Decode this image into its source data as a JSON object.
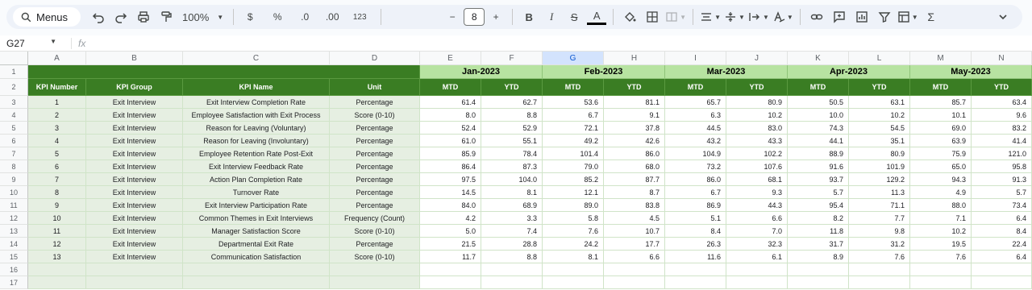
{
  "toolbar": {
    "menus_label": "Menus",
    "zoom": "100%",
    "currency": "$",
    "percent": "%",
    "dec_decrease": ".0",
    "dec_increase": ".00",
    "number_format": "123",
    "font_size": "8",
    "sum_symbol": "Σ"
  },
  "formula_bar": {
    "cell_ref": "G27",
    "fx": "fx"
  },
  "columns": [
    "A",
    "B",
    "C",
    "D",
    "E",
    "F",
    "G",
    "H",
    "I",
    "J",
    "K",
    "L",
    "M",
    "N"
  ],
  "selected_column": "G",
  "rows": [
    "1",
    "2",
    "3",
    "4",
    "5",
    "6",
    "7",
    "8",
    "9",
    "10",
    "11",
    "12",
    "13",
    "14",
    "15",
    "16",
    "17"
  ],
  "months": [
    "Jan-2023",
    "Feb-2023",
    "Mar-2023",
    "Apr-2023",
    "May-2023"
  ],
  "headers": {
    "kpi_number": "KPI Number",
    "kpi_group": "KPI Group",
    "kpi_name": "KPI Name",
    "unit": "Unit",
    "mtd": "MTD",
    "ytd": "YTD"
  },
  "data": [
    {
      "num": "1",
      "group": "Exit Interview",
      "name": "Exit Interview Completion Rate",
      "unit": "Percentage",
      "vals": [
        "61.4",
        "62.7",
        "53.6",
        "81.1",
        "65.7",
        "80.9",
        "50.5",
        "63.1",
        "85.7",
        "63.4"
      ]
    },
    {
      "num": "2",
      "group": "Exit Interview",
      "name": "Employee Satisfaction with Exit Process",
      "unit": "Score (0-10)",
      "vals": [
        "8.0",
        "8.8",
        "6.7",
        "9.1",
        "6.3",
        "10.2",
        "10.0",
        "10.2",
        "10.1",
        "9.6"
      ]
    },
    {
      "num": "3",
      "group": "Exit Interview",
      "name": "Reason for Leaving (Voluntary)",
      "unit": "Percentage",
      "vals": [
        "52.4",
        "52.9",
        "72.1",
        "37.8",
        "44.5",
        "83.0",
        "74.3",
        "54.5",
        "69.0",
        "83.2"
      ]
    },
    {
      "num": "4",
      "group": "Exit Interview",
      "name": "Reason for Leaving (Involuntary)",
      "unit": "Percentage",
      "vals": [
        "61.0",
        "55.1",
        "49.2",
        "42.6",
        "43.2",
        "43.3",
        "44.1",
        "35.1",
        "63.9",
        "41.4"
      ]
    },
    {
      "num": "5",
      "group": "Exit Interview",
      "name": "Employee Retention Rate Post-Exit",
      "unit": "Percentage",
      "vals": [
        "85.9",
        "78.4",
        "101.4",
        "86.0",
        "104.9",
        "102.2",
        "88.9",
        "80.9",
        "75.9",
        "121.0"
      ]
    },
    {
      "num": "6",
      "group": "Exit Interview",
      "name": "Exit Interview Feedback Rate",
      "unit": "Percentage",
      "vals": [
        "86.4",
        "87.3",
        "79.0",
        "68.0",
        "73.2",
        "107.6",
        "91.6",
        "101.9",
        "65.0",
        "95.8"
      ]
    },
    {
      "num": "7",
      "group": "Exit Interview",
      "name": "Action Plan Completion Rate",
      "unit": "Percentage",
      "vals": [
        "97.5",
        "104.0",
        "85.2",
        "87.7",
        "86.0",
        "68.1",
        "93.7",
        "129.2",
        "94.3",
        "91.3"
      ]
    },
    {
      "num": "8",
      "group": "Exit Interview",
      "name": "Turnover Rate",
      "unit": "Percentage",
      "vals": [
        "14.5",
        "8.1",
        "12.1",
        "8.7",
        "6.7",
        "9.3",
        "5.7",
        "11.3",
        "4.9",
        "5.7"
      ]
    },
    {
      "num": "9",
      "group": "Exit Interview",
      "name": "Exit Interview Participation Rate",
      "unit": "Percentage",
      "vals": [
        "84.0",
        "68.9",
        "89.0",
        "83.8",
        "86.9",
        "44.3",
        "95.4",
        "71.1",
        "88.0",
        "73.4"
      ]
    },
    {
      "num": "10",
      "group": "Exit Interview",
      "name": "Common Themes in Exit Interviews",
      "unit": "Frequency (Count)",
      "vals": [
        "4.2",
        "3.3",
        "5.8",
        "4.5",
        "5.1",
        "6.6",
        "8.2",
        "7.7",
        "7.1",
        "6.4"
      ]
    },
    {
      "num": "11",
      "group": "Exit Interview",
      "name": "Manager Satisfaction Score",
      "unit": "Score (0-10)",
      "vals": [
        "5.0",
        "7.4",
        "7.6",
        "10.7",
        "8.4",
        "7.0",
        "11.8",
        "9.8",
        "10.2",
        "8.4"
      ]
    },
    {
      "num": "12",
      "group": "Exit Interview",
      "name": "Departmental Exit Rate",
      "unit": "Percentage",
      "vals": [
        "21.5",
        "28.8",
        "24.2",
        "17.7",
        "26.3",
        "32.3",
        "31.7",
        "31.2",
        "19.5",
        "22.4"
      ]
    },
    {
      "num": "13",
      "group": "Exit Interview",
      "name": "Communication Satisfaction",
      "unit": "Score (0-10)",
      "vals": [
        "11.7",
        "8.8",
        "8.1",
        "6.6",
        "11.6",
        "6.1",
        "8.9",
        "7.6",
        "7.6",
        "6.4"
      ]
    }
  ],
  "colors": {
    "dark_green": "#3a7d23",
    "light_green": "#b7e3a1",
    "pale_green": "#e6efe2"
  }
}
